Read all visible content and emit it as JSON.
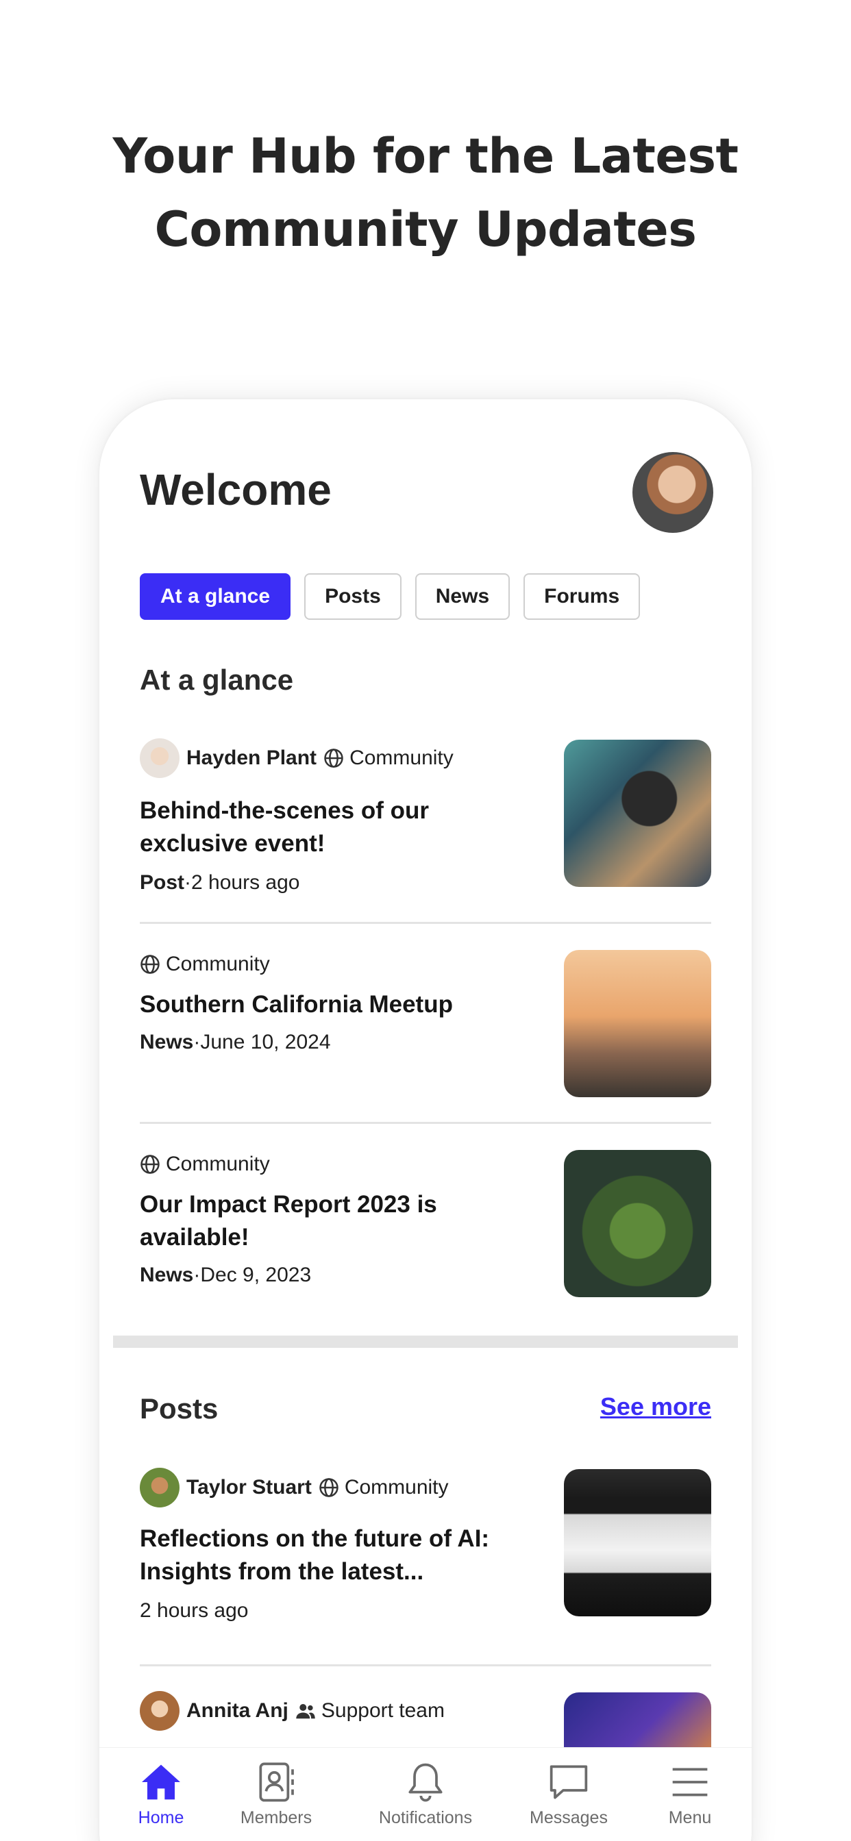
{
  "headline": {
    "line1": "Your Hub for the Latest",
    "line2": "Community Updates"
  },
  "header": {
    "title": "Welcome"
  },
  "tabs": [
    {
      "label": "At a glance",
      "active": true
    },
    {
      "label": "Posts",
      "active": false
    },
    {
      "label": "News",
      "active": false
    },
    {
      "label": "Forums",
      "active": false
    }
  ],
  "glance": {
    "title": "At a glance",
    "items": [
      {
        "author": "Hayden Plant",
        "space": "Community",
        "title": "Behind-the-scenes of our exclusive event!",
        "type": "Post",
        "time": "·2 hours ago",
        "thumb": "microphone-image"
      },
      {
        "space": "Community",
        "title": "Southern California Meetup",
        "type": "News",
        "time": "·June 10, 2024",
        "thumb": "city-sunset-image"
      },
      {
        "space": "Community",
        "title": "Our Impact Report 2023 is available!",
        "type": "News",
        "time": "·Dec 9, 2023",
        "thumb": "plant-image"
      }
    ]
  },
  "posts": {
    "title": "Posts",
    "see_more": "See more",
    "items": [
      {
        "author": "Taylor Stuart",
        "space": "Community",
        "title": "Reflections on the future of AI: Insights from the latest...",
        "time": "2 hours ago",
        "thumb": "presentation-image"
      },
      {
        "author": "Annita Anj",
        "space": "Support team",
        "thumb": "vr-headset-image"
      }
    ]
  },
  "nav": [
    {
      "label": "Home",
      "icon": "home-icon",
      "active": true
    },
    {
      "label": "Members",
      "icon": "members-icon",
      "active": false
    },
    {
      "label": "Notifications",
      "icon": "bell-icon",
      "active": false
    },
    {
      "label": "Messages",
      "icon": "chat-icon",
      "active": false
    },
    {
      "label": "Menu",
      "icon": "menu-icon",
      "active": false
    }
  ],
  "colors": {
    "accent": "#3b2df5",
    "text": "#1f1f1f",
    "muted": "#6b6b6b"
  }
}
